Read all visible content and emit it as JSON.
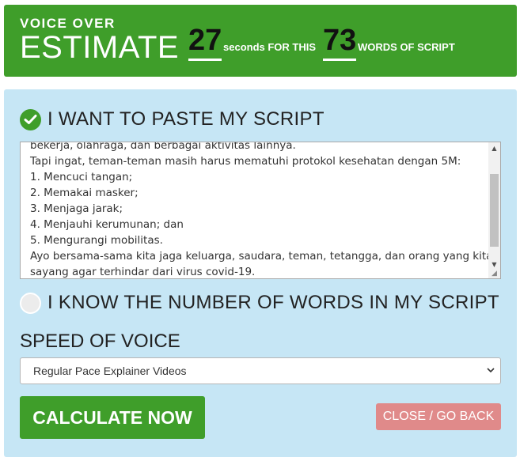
{
  "header": {
    "title_small": "VOICE OVER",
    "title_big": "ESTIMATE",
    "seconds_value": "27",
    "seconds_text": "seconds FOR THIS",
    "words_value": "73",
    "words_text": "WORDS OF SCRIPT"
  },
  "options": {
    "paste_label": "I WANT TO PASTE MY SCRIPT",
    "paste_selected": true,
    "know_label": "I KNOW THE NUMBER OF WORDS IN MY SCRIPT",
    "know_selected": false
  },
  "script": {
    "lines": [
      "bekerja, olahraga, dan berbagai aktivitas lainnya.",
      " Tapi ingat, teman-teman masih harus mematuhi protokol kesehatan dengan 5M:",
      " 1. Mencuci tangan;",
      " 2. Memakai masker;",
      " 3. Menjaga jarak;",
      " 4. Menjauhi kerumunan; dan",
      " 5. Mengurangi mobilitas.",
      " Ayo bersama-sama kita jaga keluarga, saudara, teman, tetangga, dan orang yang kita",
      "sayang agar terhindar dari virus covid-19."
    ]
  },
  "speed": {
    "label": "SPEED OF VOICE",
    "selected": "Regular Pace Explainer Videos"
  },
  "buttons": {
    "calculate": "CALCULATE NOW",
    "close": "CLOSE / GO BACK"
  },
  "colors": {
    "green": "#3f9e2a",
    "panel_blue": "#c6e6f5",
    "close_red": "#e08a8a"
  }
}
